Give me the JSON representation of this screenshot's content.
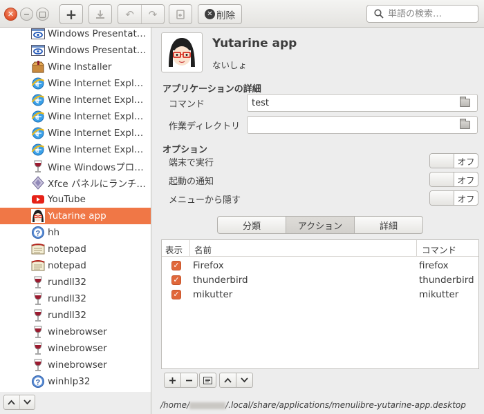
{
  "toolbar": {
    "add_label": "+",
    "undo_label": "↶",
    "redo_label": "↷",
    "delete_label": "削除",
    "search_placeholder": "単語の検索…"
  },
  "sidebar": {
    "items": [
      {
        "label": "Windows Presentation Foundation",
        "icon": "wpf-icon"
      },
      {
        "label": "Windows Presentation Foundation",
        "icon": "wpf-icon"
      },
      {
        "label": "Wine Installer",
        "icon": "wine-installer-icon"
      },
      {
        "label": "Wine Internet Explorer",
        "icon": "ie-icon"
      },
      {
        "label": "Wine Internet Explorer",
        "icon": "ie-icon"
      },
      {
        "label": "Wine Internet Explorer",
        "icon": "ie-icon"
      },
      {
        "label": "Wine Internet Explorer",
        "icon": "ie-icon"
      },
      {
        "label": "Wine Internet Explorer",
        "icon": "ie-icon"
      },
      {
        "label": "Wine Windowsプログラムローダー",
        "icon": "wine-glass-icon"
      },
      {
        "label": "Xfce パネルにランチャーを追加",
        "icon": "xfce-icon"
      },
      {
        "label": "YouTube",
        "icon": "youtube-icon"
      },
      {
        "label": "Yutarine app",
        "icon": "avatar-icon",
        "selected": true
      },
      {
        "label": "hh",
        "icon": "help-icon"
      },
      {
        "label": "notepad",
        "icon": "notepad-icon"
      },
      {
        "label": "notepad",
        "icon": "notepad-icon"
      },
      {
        "label": "rundll32",
        "icon": "wine-glass-icon"
      },
      {
        "label": "rundll32",
        "icon": "wine-glass-icon"
      },
      {
        "label": "rundll32",
        "icon": "wine-glass-icon"
      },
      {
        "label": "winebrowser",
        "icon": "wine-glass-icon"
      },
      {
        "label": "winebrowser",
        "icon": "wine-glass-icon"
      },
      {
        "label": "winebrowser",
        "icon": "wine-glass-icon"
      },
      {
        "label": "winhlp32",
        "icon": "help-icon"
      }
    ]
  },
  "app": {
    "name": "Yutarine app",
    "comment": "ないしょ"
  },
  "details": {
    "section_title": "アプリケーションの詳細",
    "command_label": "コマンド",
    "command_value": "test",
    "workdir_label": "作業ディレクトリ",
    "workdir_value": ""
  },
  "options": {
    "section_title": "オプション",
    "items": [
      {
        "label": "端末で実行",
        "state": "オフ"
      },
      {
        "label": "起動の通知",
        "state": "オフ"
      },
      {
        "label": "メニューから隠す",
        "state": "オフ"
      }
    ]
  },
  "tabs": [
    {
      "label": "分類",
      "active": false
    },
    {
      "label": "アクション",
      "active": true
    },
    {
      "label": "詳細",
      "active": false
    }
  ],
  "actions_table": {
    "headers": {
      "show": "表示",
      "name": "名前",
      "command": "コマンド"
    },
    "rows": [
      {
        "checked": true,
        "name": "Firefox",
        "command": "firefox"
      },
      {
        "checked": true,
        "name": "thunderbird",
        "command": "thunderbird"
      },
      {
        "checked": true,
        "name": "mikutter",
        "command": "mikutter"
      }
    ]
  },
  "status": {
    "path_prefix": "/home/",
    "path_suffix": "/.local/share/applications/menulibre-yutarine-app.desktop"
  },
  "colors": {
    "accent": "#f07746",
    "checkbox": "#e0673a"
  }
}
